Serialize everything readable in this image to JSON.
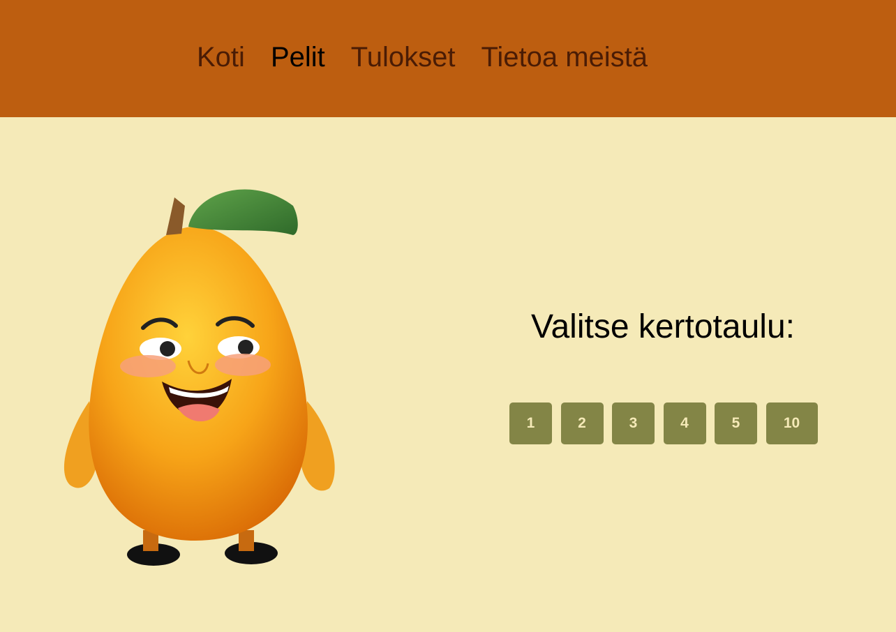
{
  "nav": {
    "items": [
      {
        "label": "Koti",
        "active": false
      },
      {
        "label": "Pelit",
        "active": true
      },
      {
        "label": "Tulokset",
        "active": false
      },
      {
        "label": "Tietoa meistä",
        "active": false
      }
    ]
  },
  "main": {
    "heading": "Valitse kertotaulu:",
    "table_buttons": [
      "1",
      "2",
      "3",
      "4",
      "5",
      "10"
    ]
  },
  "colors": {
    "header": "#bd5e10",
    "background": "#f5eab8",
    "button": "#838546",
    "button_text": "#f5eab8"
  }
}
